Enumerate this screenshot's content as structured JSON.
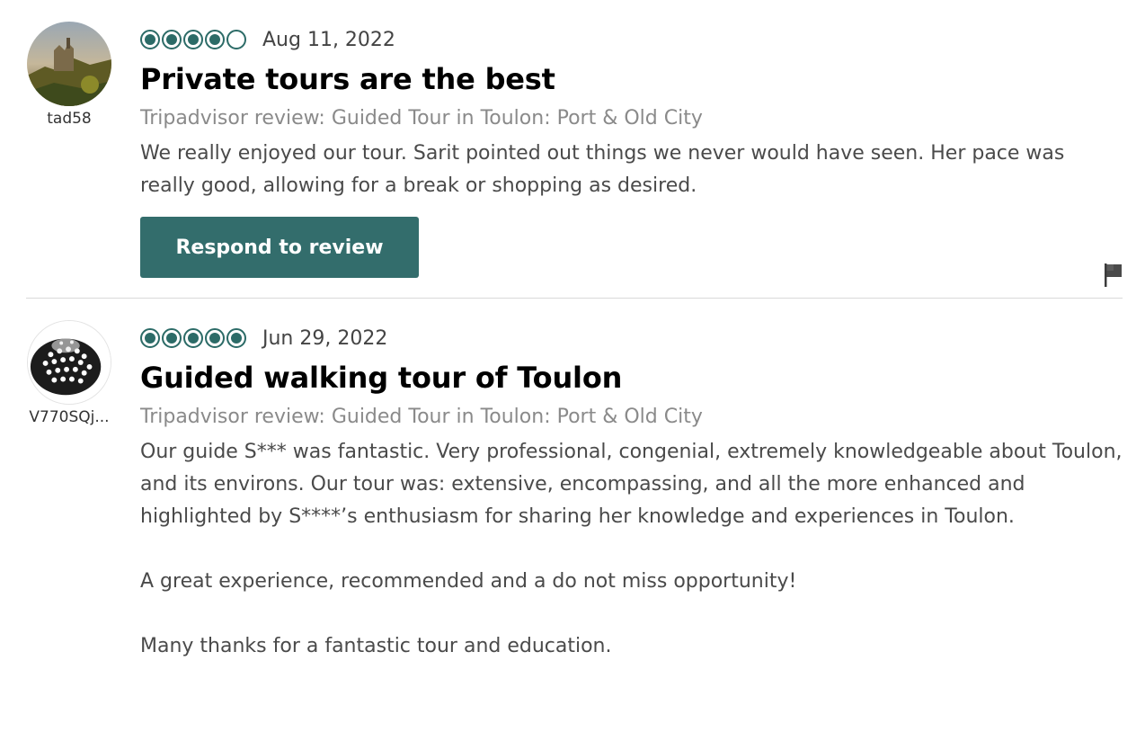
{
  "reviews": [
    {
      "username": "tad58",
      "rating": 4,
      "max_rating": 5,
      "date": "Aug 11, 2022",
      "title": "Private tours are the best",
      "source": "Tripadvisor review: Guided Tour in Toulon: Port & Old City",
      "paragraphs": [
        "We really enjoyed our tour. Sarit pointed out things we never would have seen. Her pace was really good, allowing for a break or shopping as desired."
      ],
      "respond_label": "Respond to review",
      "flag_icon": "flag-icon"
    },
    {
      "username": "V770SQj...",
      "rating": 5,
      "max_rating": 5,
      "date": "Jun 29, 2022",
      "title": "Guided walking tour of Toulon",
      "source": "Tripadvisor review: Guided Tour in Toulon: Port & Old City",
      "paragraphs": [
        "Our guide S*** was fantastic. Very professional, congenial, extremely knowledgeable about Toulon, and its environs. Our tour was: extensive, encompassing, and all the more enhanced and highlighted by S****’s enthusiasm for sharing her knowledge and experiences in Toulon.",
        "A great experience, recommended and a do not miss opportunity!",
        "Many thanks for a fantastic tour and education."
      ]
    }
  ],
  "colors": {
    "bubble": "#2c6b67",
    "button": "#336d6c",
    "divider": "#d9d9d9"
  }
}
